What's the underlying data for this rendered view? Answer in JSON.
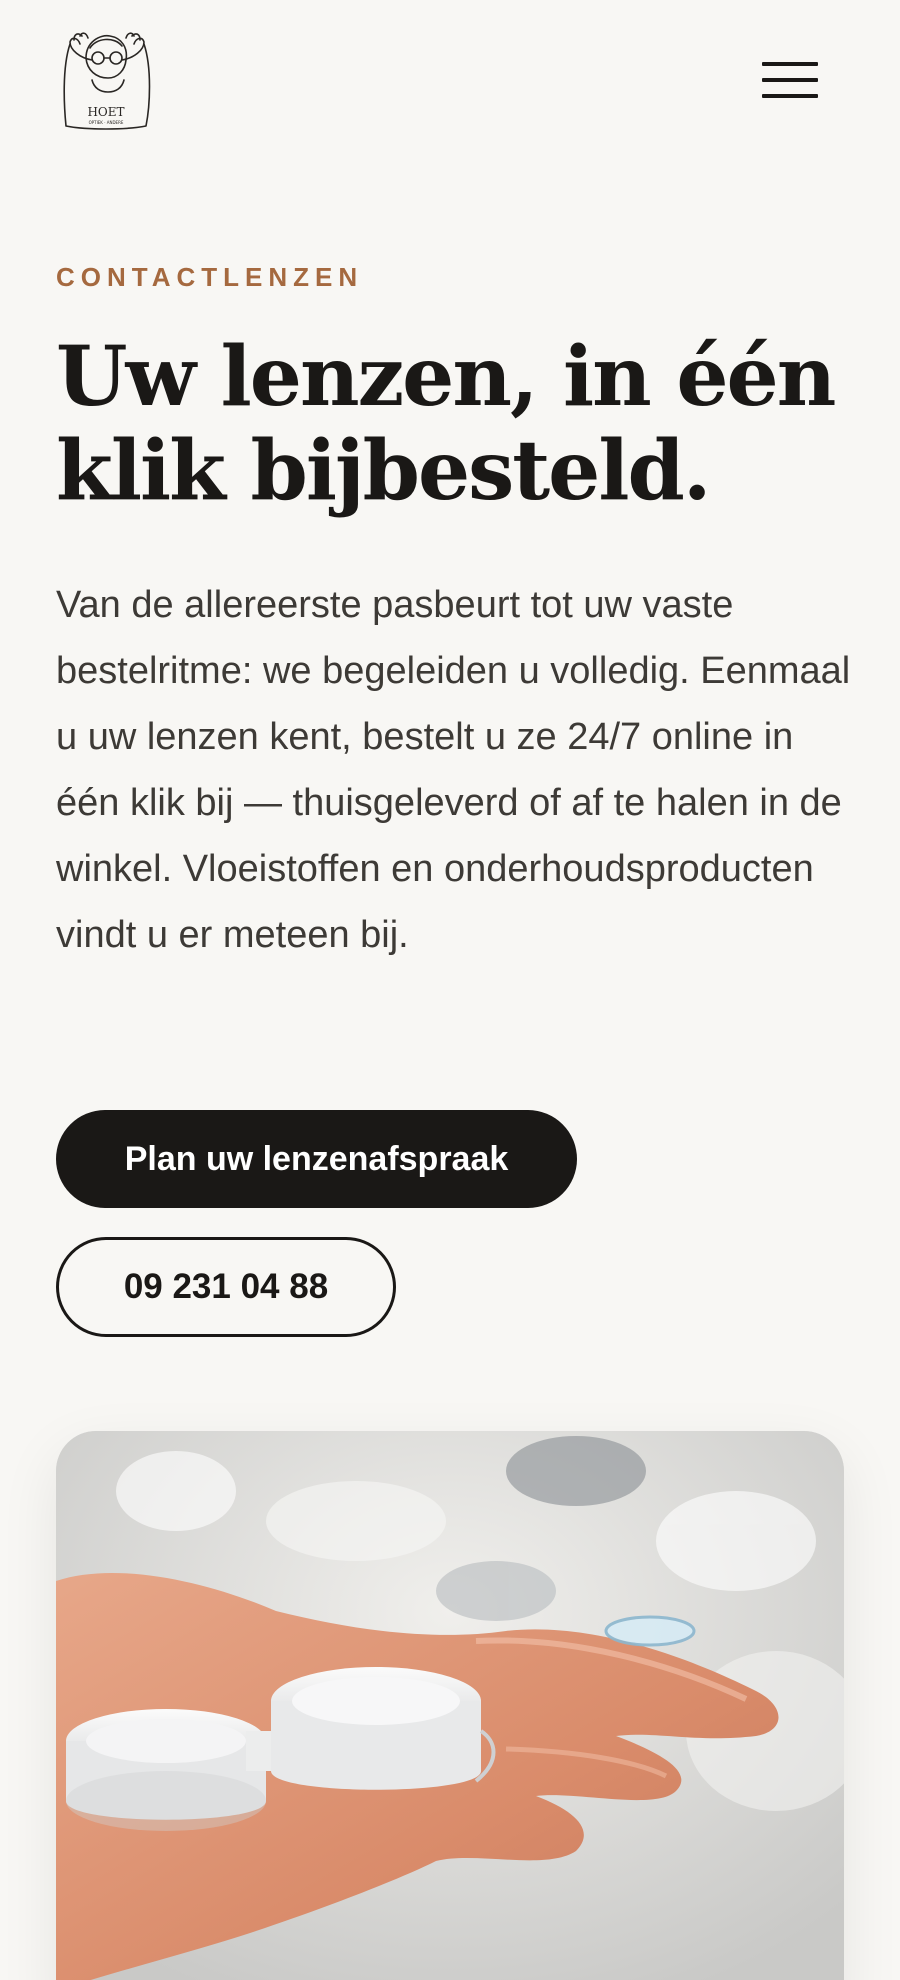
{
  "header": {
    "logo_icon": "hoet-optician-logo",
    "menu_icon": "hamburger-menu-icon"
  },
  "hero": {
    "eyebrow": "CONTACTLENZEN",
    "headline": "Uw lenzen, in één klik bijbesteld.",
    "intro": "Van de allereerste pasbeurt tot uw vaste bestelritme: we begeleiden u volledig. Eenmaal u uw lenzen kent, bestelt u ze 24/7 online in één klik bij — thuisgeleverd of af te halen in de winkel. Vloeistoffen en onderhoudsproducten vindt u er meteen bij.",
    "primary_button": "Plan uw lenzenafspraak",
    "phone_button": "09 231 04 88"
  },
  "image": {
    "description_icon": "contact-lens-case-photo"
  },
  "colors": {
    "background": "#f8f7f4",
    "accent": "#a5693f",
    "dark": "#1a1816"
  }
}
